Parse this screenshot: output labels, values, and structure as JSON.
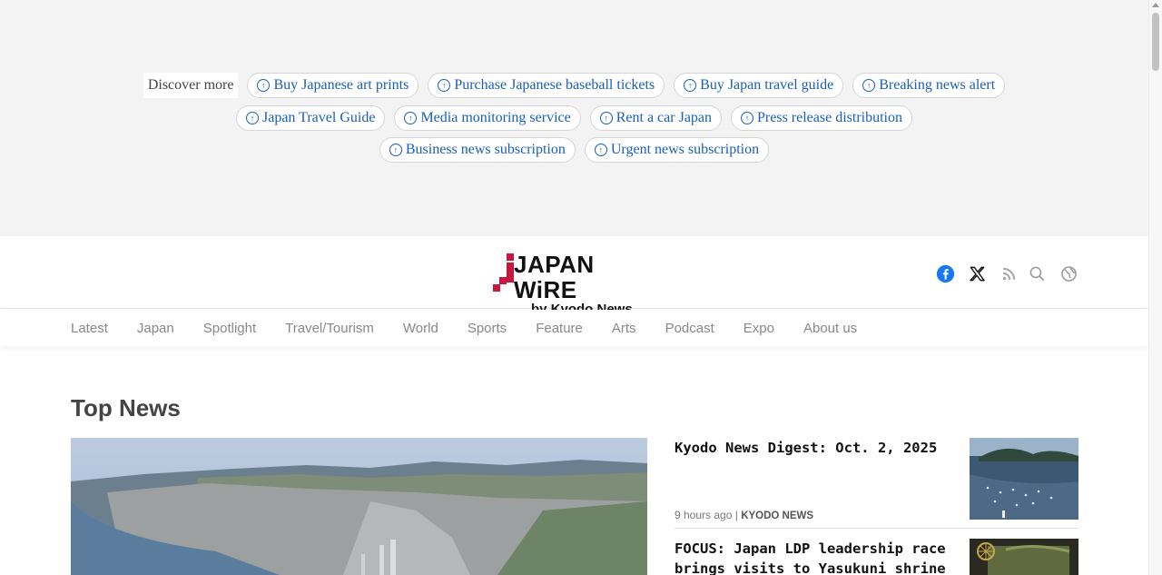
{
  "discover": {
    "label": "Discover more",
    "row1": [
      "Buy Japanese art prints",
      "Purchase Japanese baseball tickets",
      "Buy Japan travel guide",
      "Breaking news alert"
    ],
    "row2": [
      "Japan Travel Guide",
      "Media monitoring service",
      "Rent a car Japan",
      "Press release distribution"
    ],
    "row3": [
      "Business news subscription",
      "Urgent news subscription"
    ],
    "chip_icon": "arrow-circle-icon"
  },
  "header": {
    "logo_main": "JAPAN WiRE",
    "logo_sub": "by Kyodo News",
    "social_icons": [
      "facebook-icon",
      "x-icon",
      "rss-icon",
      "search-icon",
      "globe-icon"
    ]
  },
  "nav": {
    "items": [
      "Latest",
      "Japan",
      "Spotlight",
      "Travel/Tourism",
      "World",
      "Sports",
      "Feature",
      "Arts",
      "Podcast",
      "Expo",
      "About us"
    ]
  },
  "main": {
    "section_title": "Top News",
    "stories": [
      {
        "title": "Kyodo News Digest: Oct. 2, 2025",
        "time": "9 hours ago",
        "source": "KYODO NEWS"
      },
      {
        "title": "FOCUS: Japan LDP leadership race brings visits to Yasukuni shrine",
        "time": "",
        "source": ""
      }
    ]
  },
  "colors": {
    "link": "#1a5fb4",
    "band": "#f4f3f3",
    "logo_accent": "#c8173e",
    "facebook": "#1877f2"
  }
}
